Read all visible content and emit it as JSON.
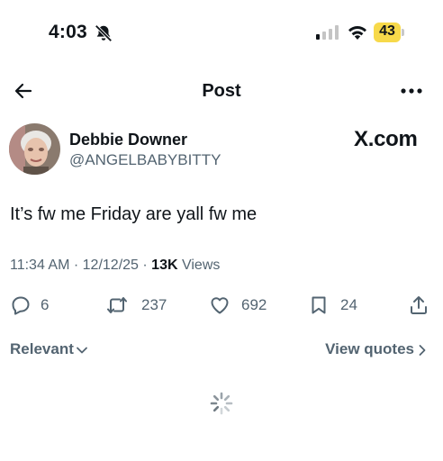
{
  "status_bar": {
    "time": "4:03",
    "battery": "43",
    "icons": [
      "bell-slash-icon",
      "signal-icon",
      "wifi-icon",
      "battery-icon"
    ]
  },
  "nav": {
    "title": "Post",
    "back_icon": "arrow-left-icon",
    "more_icon": "more-horizontal-icon"
  },
  "post": {
    "author_name": "Debbie Downer",
    "author_handle": "@ANGELBABYBITTY",
    "brand": "X.com",
    "text": "It’s fw me Friday are yall fw me",
    "time": "11:34 AM",
    "date": "12/12/25",
    "views_count": "13K",
    "views_label": "Views"
  },
  "actions": {
    "replies": "6",
    "reposts": "237",
    "likes": "692",
    "bookmarks": "24"
  },
  "footer": {
    "sort_label": "Relevant",
    "view_quotes_label": "View quotes"
  },
  "colors": {
    "text": "#0f1419",
    "secondary": "#536471",
    "battery": "#f7d94a"
  }
}
